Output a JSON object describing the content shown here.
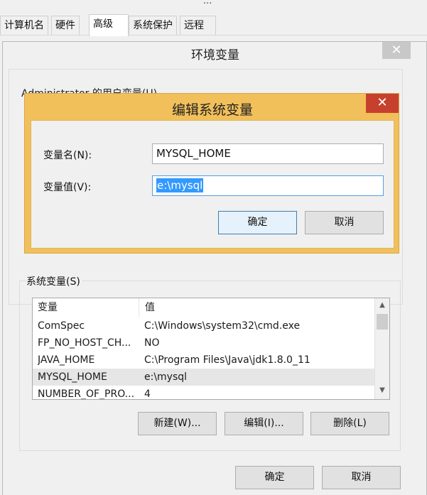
{
  "sysprops": {
    "title": "...",
    "tabs": [
      "计算机名",
      "硬件",
      "高级",
      "系统保护",
      "远程"
    ],
    "active_tab_index": 2
  },
  "env_window": {
    "title": "环境变量",
    "close_glyph": "✕",
    "user_group_label": "Administrator 的用户变量(U)",
    "sys_group_label": "系统变量(S)",
    "table": {
      "headers": [
        "变量",
        "值"
      ],
      "rows": [
        {
          "name": "ComSpec",
          "value": "C:\\Windows\\system32\\cmd.exe"
        },
        {
          "name": "FP_NO_HOST_CH...",
          "value": "NO"
        },
        {
          "name": "JAVA_HOME",
          "value": "C:\\Program Files\\Java\\jdk1.8.0_11"
        },
        {
          "name": "MYSQL_HOME",
          "value": "e:\\mysql"
        },
        {
          "name": "NUMBER_OF_PRO...",
          "value": "4"
        }
      ],
      "selected_row_index": 3
    },
    "sys_buttons": {
      "new": "新建(W)...",
      "edit": "编辑(I)...",
      "delete": "删除(L)"
    },
    "ok": "确定",
    "cancel": "取消"
  },
  "edit_dialog": {
    "title": "编辑系统变量",
    "close_glyph": "✕",
    "name_label": "变量名(N):",
    "value_label": "变量值(V):",
    "name_value": "MYSQL_HOME",
    "value_value": "e:\\mysql",
    "ok": "确定",
    "cancel": "取消"
  },
  "colors": {
    "dialog_accent": "#f2c05b",
    "close_red": "#c7402d",
    "selection_blue": "#3399ff"
  }
}
